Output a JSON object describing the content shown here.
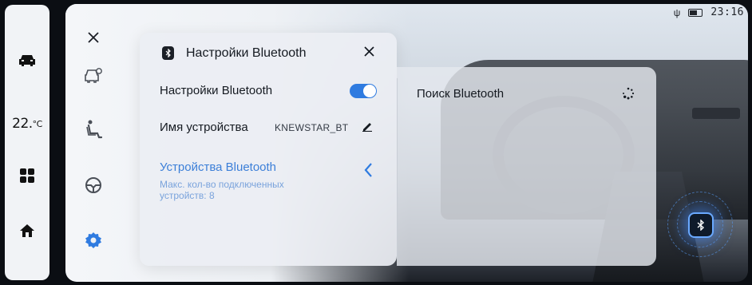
{
  "status_bar": {
    "usb_icon": "usb-icon",
    "battery_icon": "battery-icon",
    "time": "23:16"
  },
  "dock": {
    "items": [
      {
        "name": "car",
        "icon": "car-icon"
      },
      {
        "name": "climate",
        "text": "22.",
        "unit": "°C"
      },
      {
        "name": "apps",
        "icon": "grid-icon"
      },
      {
        "name": "home",
        "icon": "home-icon"
      }
    ]
  },
  "settings_sidebar": {
    "close_icon": "close-icon",
    "items": [
      {
        "name": "vehicle",
        "icon": "car-settings-icon"
      },
      {
        "name": "seat",
        "icon": "seat-icon"
      },
      {
        "name": "steering",
        "icon": "steering-wheel-icon"
      },
      {
        "name": "settings",
        "icon": "gear-icon",
        "active": true
      }
    ]
  },
  "bluetooth_panel": {
    "title": "Настройки Bluetooth",
    "toggle_label": "Настройки Bluetooth",
    "toggle_on": true,
    "device_name_label": "Имя устройства",
    "device_name_value": "KNEWSTAR_BT",
    "devices_link": "Устройства Bluetooth",
    "devices_sub": "Макс. кол-во подключенных устройств: 8",
    "search_label": "Поиск Bluetooth"
  },
  "colors": {
    "accent": "#2f7be0",
    "link": "#3c7fd8"
  }
}
